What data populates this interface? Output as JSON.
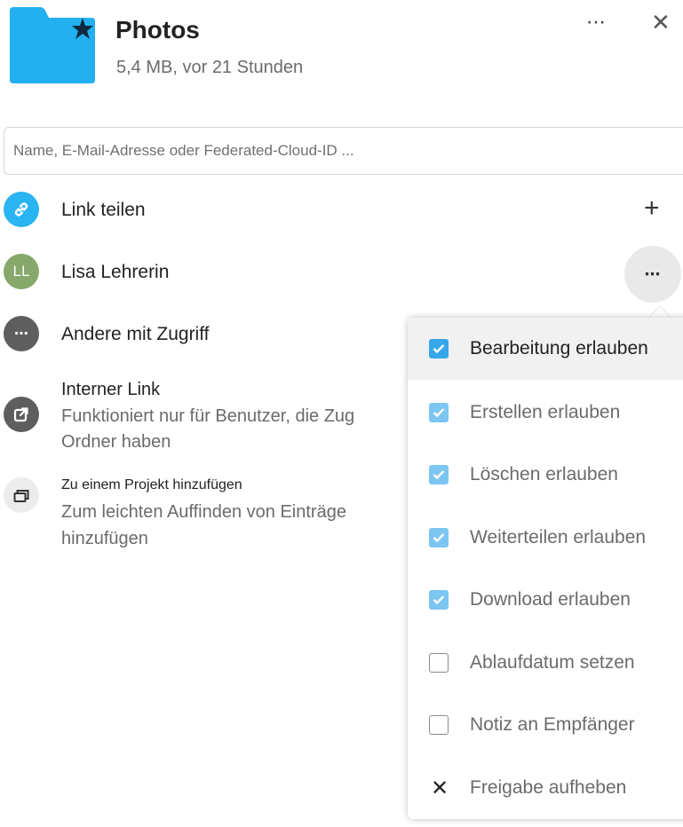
{
  "header": {
    "title": "Photos",
    "subtitle": "5,4 MB, vor 21 Stunden",
    "more_icon": "⋯",
    "close_icon": "✕",
    "folder_color": "#22b0f0"
  },
  "search": {
    "placeholder": "Name, E-Mail-Adresse oder Federated-Cloud-ID ..."
  },
  "list": {
    "link_share": {
      "label": "Link teilen",
      "add_icon": "+"
    },
    "user_share": {
      "initials": "LL",
      "name": "Lisa Lehrerin",
      "more_icon": "⋯"
    },
    "others": {
      "label": "Andere mit Zugriff"
    },
    "internal_link": {
      "label": "Interner Link",
      "sub1": "Funktioniert nur für Benutzer, die Zug",
      "sub2": "Ordner haben"
    },
    "project": {
      "label": "Zu einem Projekt hinzufügen",
      "sub1": "Zum leichten Auffinden von Einträge",
      "sub2": "hinzufügen"
    }
  },
  "menu": {
    "items": [
      {
        "label": "Bearbeitung erlauben",
        "checked": true
      },
      {
        "label": "Erstellen erlauben",
        "checked": true
      },
      {
        "label": "Löschen erlauben",
        "checked": true
      },
      {
        "label": "Weiterteilen erlauben",
        "checked": true
      },
      {
        "label": "Download erlauben",
        "checked": true
      },
      {
        "label": "Ablaufdatum setzen",
        "checked": false
      },
      {
        "label": "Notiz an Empfänger",
        "checked": false
      },
      {
        "label": "Freigabe aufheben",
        "icon": "✕"
      }
    ]
  },
  "colors": {
    "accent": "#37a6ea",
    "link_avatar": "#2ab4f2",
    "user_avatar": "#86a86b",
    "dark_avatar": "#5e5e5e",
    "light_avatar": "#ececec"
  }
}
